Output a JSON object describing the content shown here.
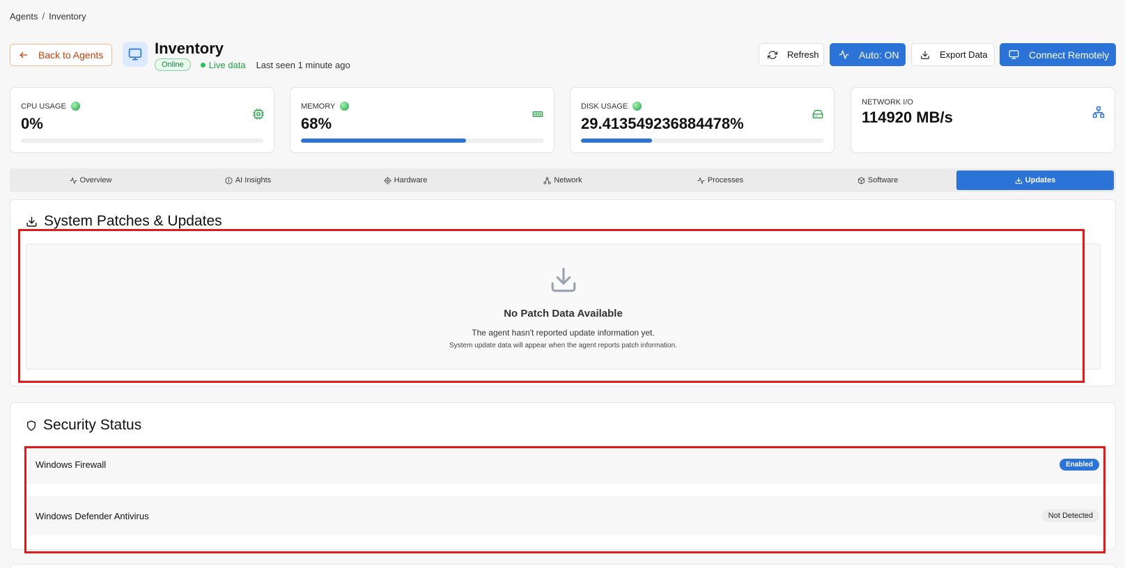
{
  "breadcrumb": {
    "parent": "Agents",
    "separator": "/",
    "current": "Inventory"
  },
  "header": {
    "back_label": "Back to Agents",
    "title": "Inventory",
    "status_badge": "Online",
    "live_label": "Live data",
    "last_seen": "Last seen 1 minute ago",
    "buttons": {
      "refresh": "Refresh",
      "auto": "Auto: ON",
      "export": "Export Data",
      "connect": "Connect Remotely"
    }
  },
  "stats": {
    "cpu": {
      "label": "CPU USAGE",
      "value": "0%",
      "progress": 0
    },
    "memory": {
      "label": "MEMORY",
      "value": "68%",
      "progress": 68
    },
    "disk": {
      "label": "DISK USAGE",
      "value": "29.413549236884478%",
      "progress": 29.413549236884478
    },
    "network": {
      "label": "NETWORK I/O",
      "value": "114920 MB/s"
    }
  },
  "tabs": [
    {
      "label": "Overview",
      "icon": "activity-icon"
    },
    {
      "label": "AI Insights",
      "icon": "info-icon"
    },
    {
      "label": "Hardware",
      "icon": "gear-icon"
    },
    {
      "label": "Network",
      "icon": "network-icon"
    },
    {
      "label": "Processes",
      "icon": "activity-icon"
    },
    {
      "label": "Software",
      "icon": "package-icon"
    },
    {
      "label": "Updates",
      "icon": "download-icon",
      "active": true
    }
  ],
  "patches": {
    "title": "System Patches & Updates",
    "empty_title": "No Patch Data Available",
    "empty_line1": "The agent hasn't reported update information yet.",
    "empty_line2": "System update data will appear when the agent reports patch information."
  },
  "security": {
    "title": "Security Status",
    "items": [
      {
        "name": "Windows Firewall",
        "status": "Enabled"
      },
      {
        "name": "Windows Defender Antivirus",
        "status": "Not Detected"
      }
    ]
  },
  "colors": {
    "primary": "#2b73d6",
    "online": "#15803d",
    "back_accent": "#c2410c",
    "highlight": "#e01919"
  }
}
